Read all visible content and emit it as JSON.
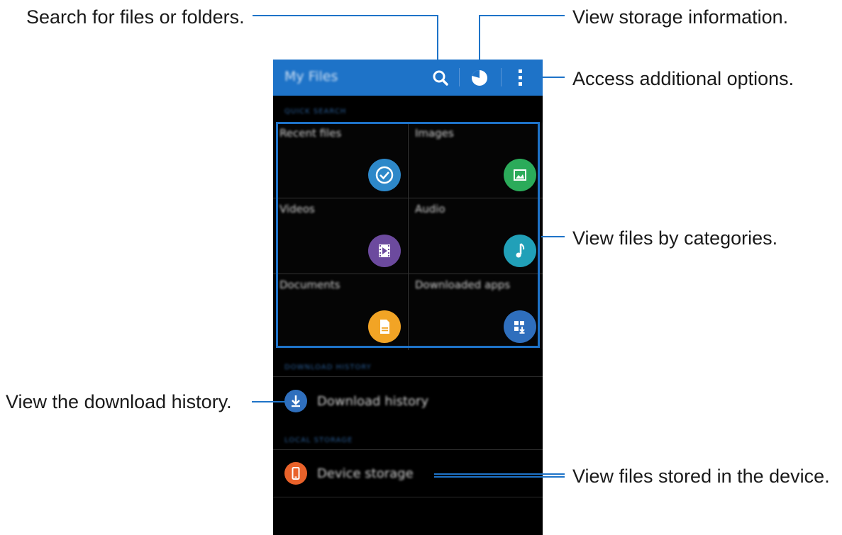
{
  "app": {
    "title": "My Files",
    "sections": {
      "quick_search": "QUICK SEARCH",
      "download_history": "DOWNLOAD HISTORY",
      "local_storage": "LOCAL STORAGE"
    },
    "categories": [
      {
        "label": "Recent files",
        "icon": "clock-icon",
        "color": "#2d88c9"
      },
      {
        "label": "Images",
        "icon": "image-icon",
        "color": "#2bab5a"
      },
      {
        "label": "Videos",
        "icon": "video-icon",
        "color": "#6c4a9e"
      },
      {
        "label": "Audio",
        "icon": "music-note-icon",
        "color": "#21a0b8"
      },
      {
        "label": "Documents",
        "icon": "document-icon",
        "color": "#f2a425"
      },
      {
        "label": "Downloaded apps",
        "icon": "download-apps-icon",
        "color": "#2f6fbd"
      }
    ],
    "download_history_item": {
      "label": "Download history",
      "icon": "download-icon",
      "color": "#2f6fbd"
    },
    "device_storage_item": {
      "label": "Device storage",
      "icon": "phone-icon",
      "color": "#e9622a"
    },
    "accent_color": "#1e73c8"
  },
  "callouts": {
    "search": "Search for files or folders.",
    "storage": "View storage information.",
    "options": "Access additional options.",
    "categories": "View files by categories.",
    "download_history": "View the download history.",
    "device_storage": "View files stored in the device."
  }
}
